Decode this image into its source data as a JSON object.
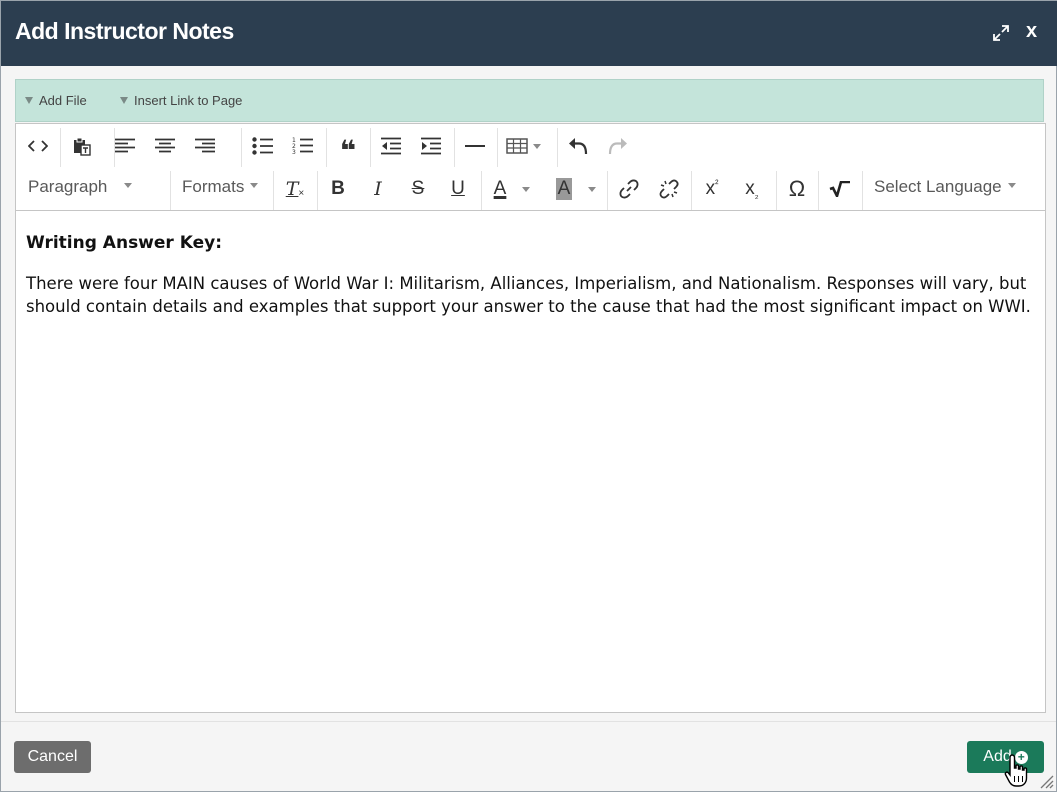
{
  "dialog": {
    "title": "Add Instructor Notes",
    "close_label": "x"
  },
  "attachments": {
    "add_file": "Add File",
    "insert_link": "Insert Link to Page"
  },
  "toolbar": {
    "paragraph": "Paragraph",
    "formats": "Formats",
    "select_language": "Select Language",
    "bold": "B",
    "italic": "I",
    "strikethrough": "S",
    "underline": "U",
    "text_color": "A",
    "bg_color": "A",
    "omega": "Ω",
    "icons": [
      "code-icon",
      "paste-text-icon",
      "align-left-icon",
      "align-center-icon",
      "align-right-icon",
      "bullet-list-icon",
      "numbered-list-icon",
      "blockquote-icon",
      "outdent-icon",
      "indent-icon",
      "horizontal-rule-icon",
      "table-icon",
      "undo-icon",
      "redo-icon",
      "clear-formatting-icon",
      "link-icon",
      "unlink-icon",
      "superscript-icon",
      "subscript-icon",
      "special-character-icon",
      "math-icon"
    ]
  },
  "content": {
    "heading": "Writing Answer Key:",
    "body": "There were four MAIN causes of World War I: Militarism, Alliances, Imperialism, and Nationalism. Responses will vary, but should contain details and examples that support your answer to the cause that had the most significant impact on WWI."
  },
  "footer": {
    "cancel_label": "Cancel",
    "add_label": "Add"
  },
  "colors": {
    "titlebar": "#2c3e50",
    "attach_bar": "#c4e4da",
    "add_button": "#1b7a5a",
    "cancel_button": "#6d6d6d"
  }
}
